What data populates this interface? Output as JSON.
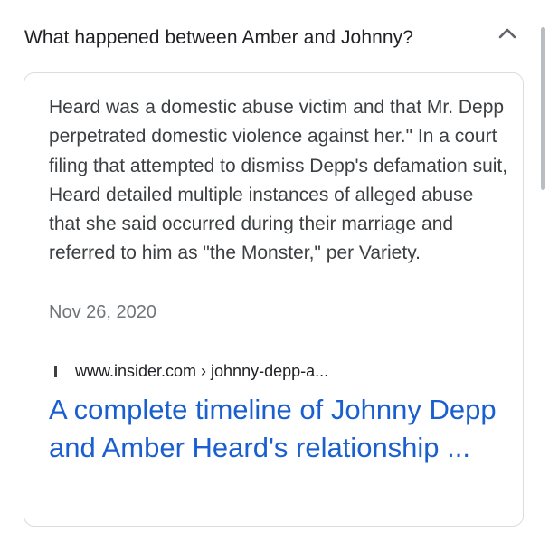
{
  "question": {
    "text": "What happened between Amber and Johnny?",
    "toggle_icon": "chevron-up-icon"
  },
  "answer": {
    "snippet": "Heard was a domestic abuse victim and that Mr. Depp perpetrated domestic violence against her.\" In a court filing that attempted to dismiss Depp's defamation suit, Heard detailed multiple instances of alleged abuse that she said occurred during their marriage and referred to him as \"the Monster,\" per Variety.",
    "date": "Nov 26, 2020",
    "source": {
      "favicon": "site-favicon-icon",
      "url": "www.insider.com › johnny-depp-a..."
    },
    "title": "A complete timeline of Johnny Depp and Amber Heard's relationship ..."
  },
  "colors": {
    "link": "#1a5fd0",
    "text": "#3c4043",
    "meta": "#70757a",
    "border": "#dadce0"
  }
}
